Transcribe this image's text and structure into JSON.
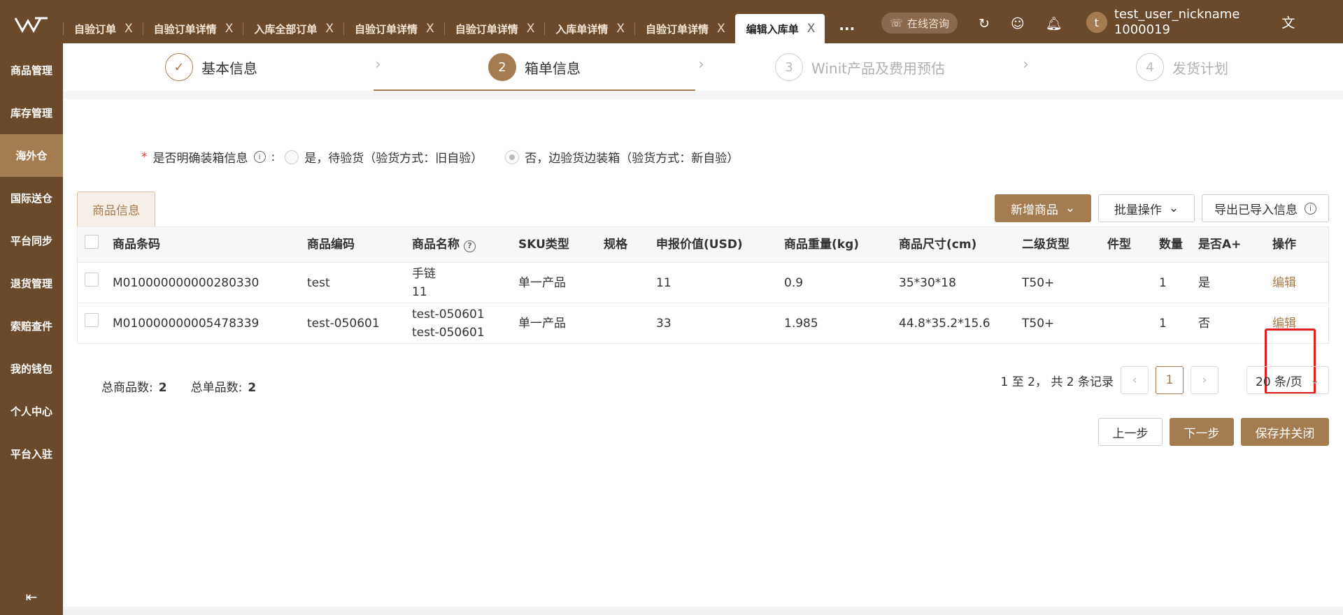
{
  "sidebar": {
    "items": [
      {
        "label": "商品管理"
      },
      {
        "label": "库存管理"
      },
      {
        "label": "海外仓"
      },
      {
        "label": "国际送仓"
      },
      {
        "label": "平台同步"
      },
      {
        "label": "退货管理"
      },
      {
        "label": "索赔查件"
      },
      {
        "label": "我的钱包"
      },
      {
        "label": "个人中心"
      },
      {
        "label": "平台入驻"
      }
    ],
    "active_index": 2
  },
  "tabs": [
    {
      "label": "自验订单",
      "close": "X"
    },
    {
      "label": "自验订单详情",
      "close": "X"
    },
    {
      "label": "入库全部订单",
      "close": "X"
    },
    {
      "label": "自验订单详情",
      "close": "X"
    },
    {
      "label": "自验订单详情",
      "close": "X"
    },
    {
      "label": "入库单详情",
      "close": "X"
    },
    {
      "label": "自验订单详情",
      "close": "X"
    },
    {
      "label": "编辑入库单",
      "close": "X"
    }
  ],
  "topbar": {
    "more": "···",
    "consult_label": "在线咨询",
    "avatar_letter": "t",
    "username": "test_user_nickname",
    "user_id": "1000019"
  },
  "steps": [
    {
      "num": "✓",
      "label": "基本信息"
    },
    {
      "num": "2",
      "label": "箱单信息"
    },
    {
      "num": "3",
      "label": "Winit产品及费用预估"
    },
    {
      "num": "4",
      "label": "发货计划"
    }
  ],
  "packing": {
    "required_mark": "*",
    "question": "是否明确装箱信息",
    "colon": ":",
    "option_yes": "是，待验货（验货方式：旧自验）",
    "option_no": "否，边验货边装箱（验货方式：新自验）"
  },
  "product_tab": "商品信息",
  "buttons": {
    "add_product": "新增商品",
    "batch_ops": "批量操作",
    "export": "导出已导入信息",
    "prev": "上一步",
    "next": "下一步",
    "save_close": "保存并关闭"
  },
  "table": {
    "headers": [
      "商品条码",
      "商品编码",
      "商品名称",
      "SKU类型",
      "规格",
      "申报价值(USD)",
      "商品重量(kg)",
      "商品尺寸(cm)",
      "二级货型",
      "件型",
      "数量",
      "是否A+",
      "操作"
    ],
    "rows": [
      {
        "barcode": "M010000000000280330",
        "code": "test",
        "name1": "手链",
        "name2": "11",
        "sku_type": "单一产品",
        "spec": "",
        "value": "11",
        "weight": "0.9",
        "size": "35*30*18",
        "cargo": "T50+",
        "piece": "",
        "qty": "1",
        "aplus": "是",
        "action": "编辑"
      },
      {
        "barcode": "M010000000005478339",
        "code": "test-050601",
        "name1": "test-050601",
        "name2": "test-050601",
        "sku_type": "单一产品",
        "spec": "",
        "value": "33",
        "weight": "1.985",
        "size": "44.8*35.2*15.6",
        "cargo": "T50+",
        "piece": "",
        "qty": "1",
        "aplus": "否",
        "action": "编辑"
      }
    ]
  },
  "summary": {
    "total_products_label": "总商品数:",
    "total_products": "2",
    "total_single_label": "总单品数:",
    "total_single": "2"
  },
  "pagination": {
    "range_text": "1 至 2， 共 2 条记录",
    "current_page": "1",
    "page_size": "20 条/页"
  },
  "colors": {
    "brand": "#6b4a2c",
    "accent": "#a57c4f",
    "highlight": "#e02020"
  }
}
